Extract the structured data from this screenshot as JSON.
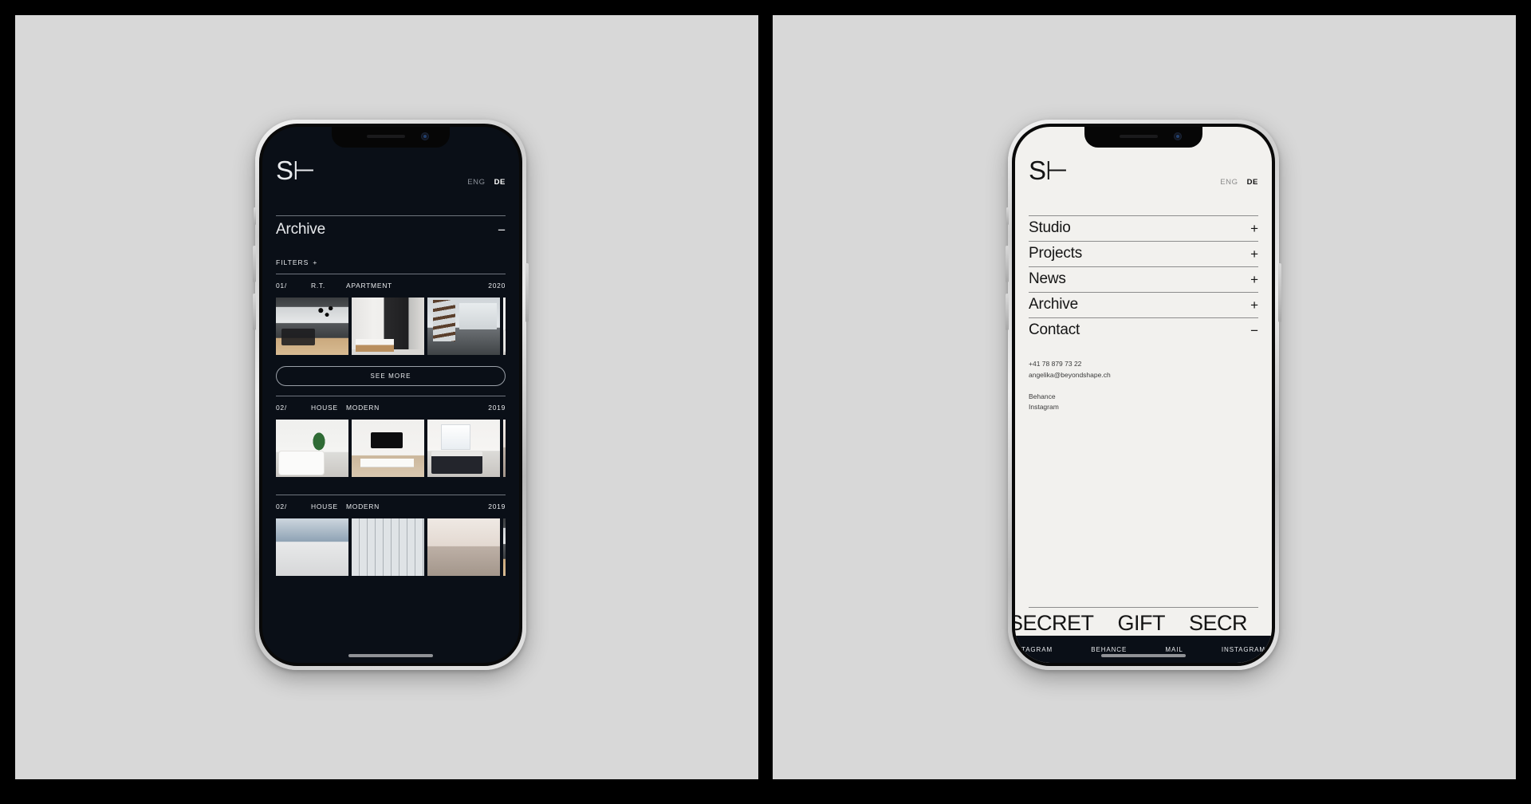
{
  "canvas": {
    "background": "#000000",
    "panel_background": "#d8d8d8"
  },
  "left_phone": {
    "theme": "dark",
    "screen_background": "#0a0f17",
    "logo": "S⊢",
    "language": {
      "inactive": "ENG",
      "active": "DE"
    },
    "section": {
      "title": "Archive",
      "toggle": "−"
    },
    "filters": {
      "label": "FILTERS",
      "toggle": "+"
    },
    "see_more_label": "SEE MORE",
    "projects": [
      {
        "number": "01/",
        "tag_a": "R.T.",
        "tag_b": "APARTMENT",
        "year": "2020",
        "thumbs": [
          "kitchen-dining-interior",
          "bathroom-dark-stone",
          "staircase-open-plan",
          "partial-next-image"
        ]
      },
      {
        "number": "02/",
        "tag_a": "HOUSE",
        "tag_b": "MODERN",
        "year": "2019",
        "thumbs": [
          "white-living-room",
          "tv-wall-living-room",
          "bedroom-dark-bedding",
          "partial-next-image"
        ]
      },
      {
        "number": "02/",
        "tag_a": "HOUSE",
        "tag_b": "MODERN",
        "year": "2019",
        "thumbs": [
          "blue-toned-room",
          "window-wall",
          "warm-corner",
          "partial-next-image"
        ]
      }
    ]
  },
  "right_phone": {
    "theme": "light",
    "screen_background": "#f2f1ee",
    "logo": "S⊢",
    "language": {
      "inactive": "ENG",
      "active": "DE"
    },
    "menu": [
      {
        "label": "Studio",
        "toggle": "+"
      },
      {
        "label": "Projects",
        "toggle": "+"
      },
      {
        "label": "News",
        "toggle": "+"
      },
      {
        "label": "Archive",
        "toggle": "+"
      },
      {
        "label": "Contact",
        "toggle": "−"
      }
    ],
    "contact": {
      "phone": "+41 78 879 73 22",
      "email": "angelika@beyondshape.ch",
      "social": [
        "Behance",
        "Instagram"
      ]
    },
    "marquee": [
      "SECRET",
      "GIFT",
      "SECR"
    ],
    "footer_links": [
      "TAGRAM",
      "BEHANCE",
      "MAIL",
      "INSTAGRAM"
    ]
  }
}
